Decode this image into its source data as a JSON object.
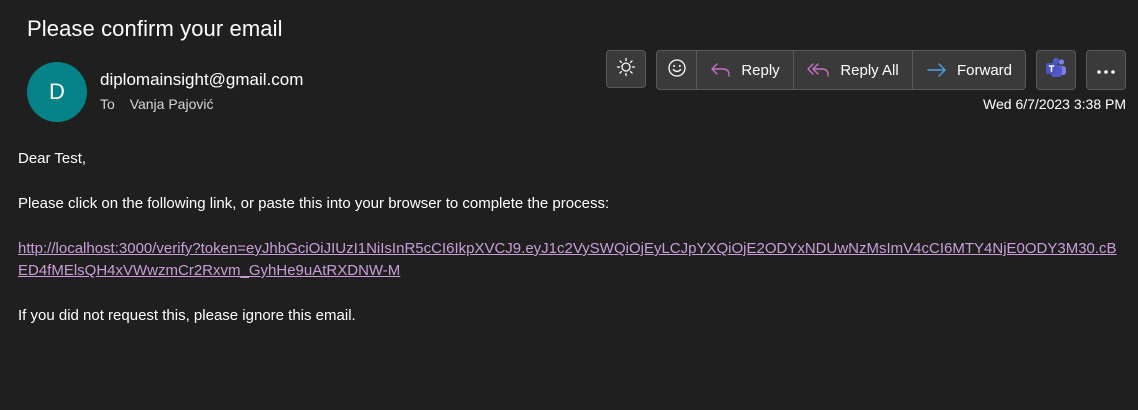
{
  "email": {
    "subject": "Please confirm your email",
    "avatar_initial": "D",
    "avatar_color": "#038387",
    "sender": "diplomainsight@gmail.com",
    "to_label": "To",
    "recipient": "Vanja Pajović",
    "date": "Wed 6/7/2023 3:38 PM"
  },
  "toolbar": {
    "theme_icon": "sun-icon",
    "emoji_icon": "smiley-icon",
    "reply_label": "Reply",
    "reply_all_label": "Reply All",
    "forward_label": "Forward",
    "teams_icon": "teams-icon",
    "more_icon": "more-icon"
  },
  "message": {
    "greeting": "Dear Test,",
    "instruction": "Please click on the following link, or paste this into your browser to complete the process:",
    "link": "http://localhost:3000/verify?token=eyJhbGciOiJIUzI1NiIsInR5cCI6IkpXVCJ9.eyJ1c2VySWQiOjEyLCJpYXQiOjE2ODYxNDUwNzMsImV4cCI6MTY4NjE0ODY3M30.cBED4fMElsQH4xVWwzmCr2Rxvm_GyhHe9uAtRXDNW-M",
    "footer": "If you did not request this, please ignore this email."
  },
  "colors": {
    "background": "#1f1f1f",
    "link": "#c99ed8",
    "reply_icon": "#c670c6",
    "forward_icon": "#4aa0e6"
  }
}
